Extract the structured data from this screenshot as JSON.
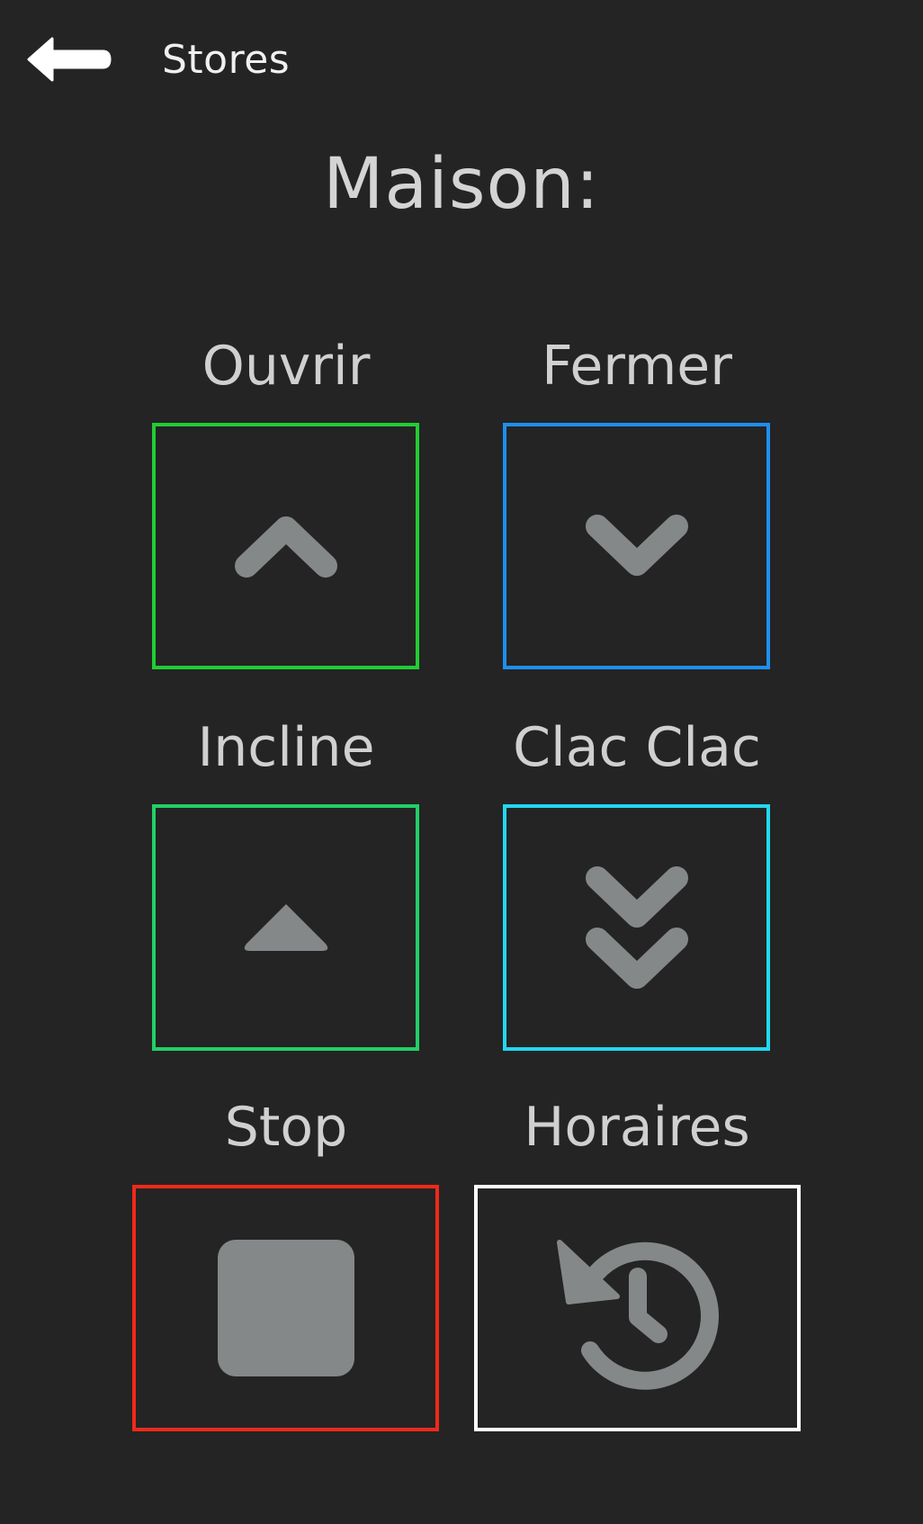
{
  "header": {
    "back_icon": "arrow-left-icon",
    "title": "Stores"
  },
  "page": {
    "title": "Maison:"
  },
  "controls": [
    {
      "id": "ouvrir",
      "label": "Ouvrir",
      "icon": "chevron-up-icon",
      "color": "#22cc33"
    },
    {
      "id": "fermer",
      "label": "Fermer",
      "icon": "chevron-down-icon",
      "color": "#1e8ff0"
    },
    {
      "id": "incline",
      "label": "Incline",
      "icon": "triangle-up-icon",
      "color": "#22d066"
    },
    {
      "id": "clac-clac",
      "label": "Clac Clac",
      "icon": "double-chevron-down-icon",
      "color": "#22d8f0"
    },
    {
      "id": "stop",
      "label": "Stop",
      "icon": "stop-square-icon",
      "color": "#ee2a1a"
    },
    {
      "id": "horaires",
      "label": "Horaires",
      "icon": "history-clock-icon",
      "color": "#ffffff"
    }
  ],
  "icon_color": "#848888"
}
